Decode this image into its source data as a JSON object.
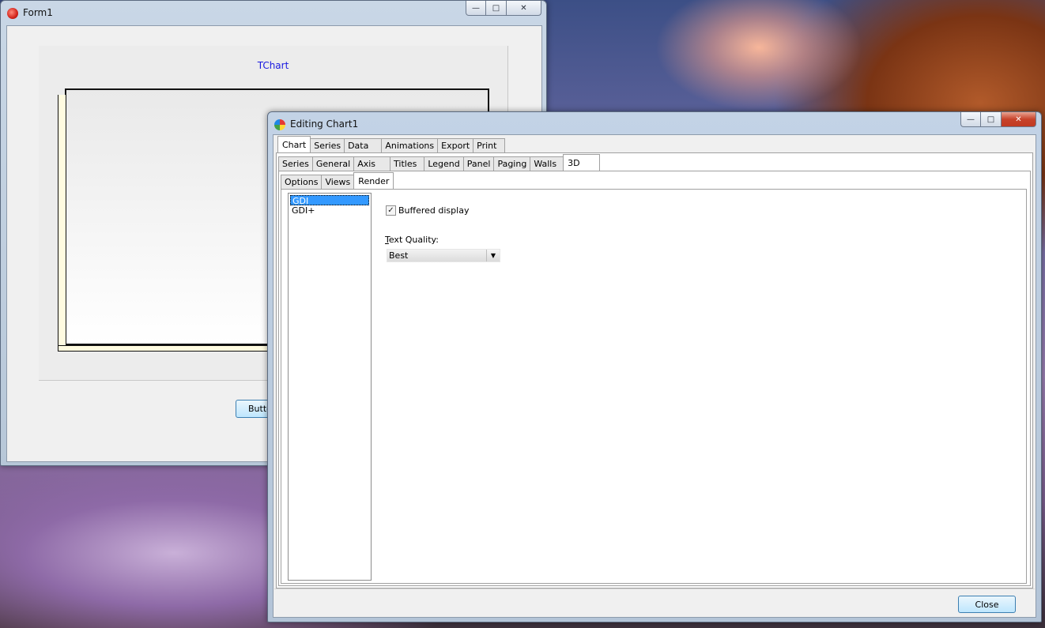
{
  "form1": {
    "title": "Form1",
    "chart_title": "TChart",
    "button_label": "Butto"
  },
  "editor": {
    "title": "Editing Chart1",
    "main_tabs": [
      "Chart",
      "Series",
      "Data",
      "Animations",
      "Export",
      "Print"
    ],
    "chart_tabs": [
      "Series",
      "General",
      "Axis",
      "Titles",
      "Legend",
      "Panel",
      "Paging",
      "Walls",
      "3D"
    ],
    "sub_tabs": [
      "Options",
      "Views",
      "Render"
    ],
    "render_list": [
      "GDI",
      "GDI+"
    ],
    "buffered_display_label": "Buffered display",
    "buffered_display_checked": true,
    "text_quality_label_u": "T",
    "text_quality_label_rest": "ext Quality:",
    "text_quality_value": "Best",
    "close_label": "Close"
  },
  "colors": {
    "chart_title": "#1a1ae0",
    "selection": "#3399ff",
    "wall": "#fffbe0"
  }
}
